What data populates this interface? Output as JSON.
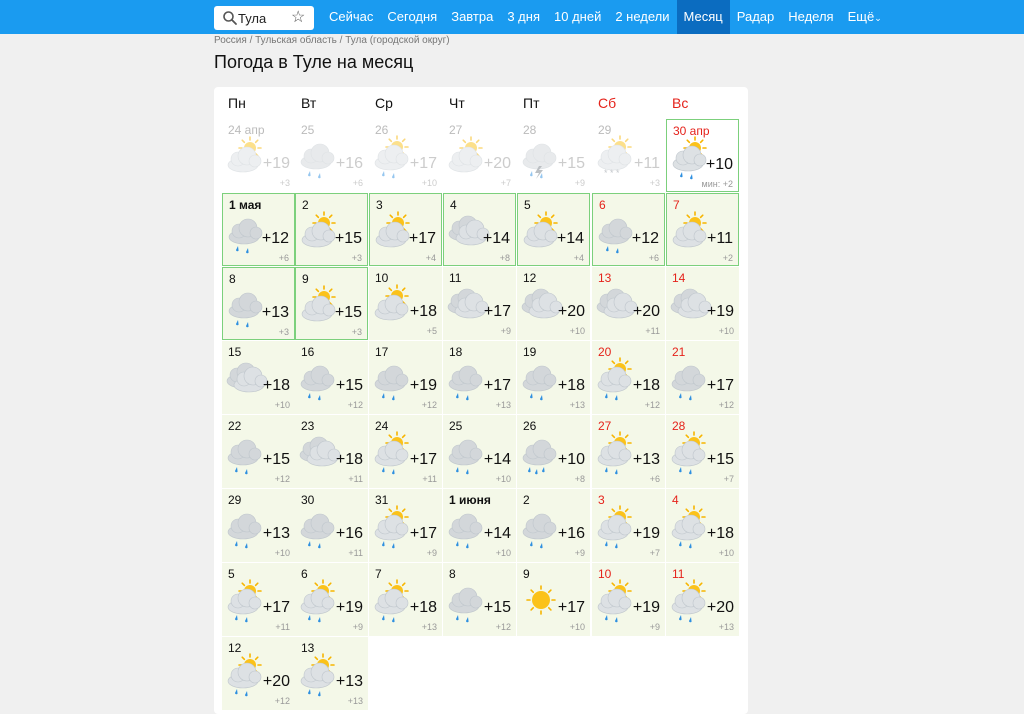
{
  "search": {
    "value": "Тула",
    "star": "☆"
  },
  "nav": [
    {
      "label": "Сейчас",
      "active": false
    },
    {
      "label": "Сегодня",
      "active": false
    },
    {
      "label": "Завтра",
      "active": false
    },
    {
      "label": "3 дня",
      "active": false
    },
    {
      "label": "10 дней",
      "active": false
    },
    {
      "label": "2 недели",
      "active": false
    },
    {
      "label": "Месяц",
      "active": true
    },
    {
      "label": "Радар",
      "active": false
    },
    {
      "label": "Неделя",
      "active": false
    },
    {
      "label": "Ещё",
      "active": false
    }
  ],
  "breadcrumb": "Россия / Тульская область / Тула (городской округ)",
  "title": "Погода в Туле на месяц",
  "weekdays": [
    {
      "label": "Пн",
      "weekend": false
    },
    {
      "label": "Вт",
      "weekend": false
    },
    {
      "label": "Ср",
      "weekend": false
    },
    {
      "label": "Чт",
      "weekend": false
    },
    {
      "label": "Пт",
      "weekend": false
    },
    {
      "label": "Сб",
      "weekend": true
    },
    {
      "label": "Вс",
      "weekend": true
    }
  ],
  "colors": {
    "nav_bg": "#1a9bf0",
    "nav_active": "#0b6cc0",
    "weekend": "#e5231b",
    "future_bg": "#f4f8e8",
    "border": "#7cd07c"
  },
  "min_prefix": "мин: ",
  "days": [
    {
      "label": "24 апр",
      "day": "",
      "max": "+19",
      "min": "+3",
      "icon": "partly-cloudy",
      "past": true
    },
    {
      "label": "25",
      "day": "",
      "max": "+16",
      "min": "+6",
      "icon": "cloudy-rain",
      "past": true
    },
    {
      "label": "26",
      "day": "",
      "max": "+17",
      "min": "+10",
      "icon": "partly-rain",
      "past": true
    },
    {
      "label": "27",
      "day": "",
      "max": "+20",
      "min": "+7",
      "icon": "partly-cloudy",
      "past": true
    },
    {
      "label": "28",
      "day": "",
      "max": "+15",
      "min": "+9",
      "icon": "thunderstorm",
      "past": true
    },
    {
      "label": "29",
      "day": "",
      "max": "+11",
      "min": "+3",
      "icon": "snow",
      "past": true
    },
    {
      "label": "30 апр",
      "day": "",
      "max": "+10",
      "min": "+2",
      "icon": "partly-rain",
      "today": true,
      "red": true
    },
    {
      "label": "1 мая",
      "max": "+12",
      "min": "+6",
      "icon": "cloudy-rain",
      "box": true,
      "bold": true
    },
    {
      "label": "2",
      "max": "+15",
      "min": "+3",
      "icon": "partly-cloudy",
      "box": true
    },
    {
      "label": "3",
      "max": "+17",
      "min": "+4",
      "icon": "partly-cloudy",
      "box": true
    },
    {
      "label": "4",
      "max": "+14",
      "min": "+8",
      "icon": "cloudy",
      "box": true
    },
    {
      "label": "5",
      "max": "+14",
      "min": "+4",
      "icon": "partly-cloudy",
      "box": true
    },
    {
      "label": "6",
      "max": "+12",
      "min": "+6",
      "icon": "cloudy-rain",
      "box": true,
      "red": true
    },
    {
      "label": "7",
      "max": "+11",
      "min": "+2",
      "icon": "partly-cloudy",
      "box": true,
      "red": true
    },
    {
      "label": "8",
      "max": "+13",
      "min": "+3",
      "icon": "cloudy-rain",
      "box": true
    },
    {
      "label": "9",
      "max": "+15",
      "min": "+3",
      "icon": "partly-cloudy",
      "box": true
    },
    {
      "label": "10",
      "max": "+18",
      "min": "+5",
      "icon": "partly-cloudy"
    },
    {
      "label": "11",
      "max": "+17",
      "min": "+9",
      "icon": "cloudy"
    },
    {
      "label": "12",
      "max": "+20",
      "min": "+10",
      "icon": "cloudy"
    },
    {
      "label": "13",
      "max": "+20",
      "min": "+11",
      "icon": "cloudy",
      "red": true
    },
    {
      "label": "14",
      "max": "+19",
      "min": "+10",
      "icon": "cloudy",
      "red": true
    },
    {
      "label": "15",
      "max": "+18",
      "min": "+10",
      "icon": "cloudy"
    },
    {
      "label": "16",
      "max": "+15",
      "min": "+12",
      "icon": "cloudy-rain"
    },
    {
      "label": "17",
      "max": "+19",
      "min": "+12",
      "icon": "cloudy-rain"
    },
    {
      "label": "18",
      "max": "+17",
      "min": "+13",
      "icon": "cloudy-rain"
    },
    {
      "label": "19",
      "max": "+18",
      "min": "+13",
      "icon": "cloudy-rain"
    },
    {
      "label": "20",
      "max": "+18",
      "min": "+12",
      "icon": "partly-rain",
      "red": true
    },
    {
      "label": "21",
      "max": "+17",
      "min": "+12",
      "icon": "cloudy-rain",
      "red": true
    },
    {
      "label": "22",
      "max": "+15",
      "min": "+12",
      "icon": "cloudy-rain"
    },
    {
      "label": "23",
      "max": "+18",
      "min": "+11",
      "icon": "cloudy"
    },
    {
      "label": "24",
      "max": "+17",
      "min": "+11",
      "icon": "partly-rain"
    },
    {
      "label": "25",
      "max": "+14",
      "min": "+10",
      "icon": "cloudy-rain"
    },
    {
      "label": "26",
      "max": "+10",
      "min": "+8",
      "icon": "cloudy-heavy-rain"
    },
    {
      "label": "27",
      "max": "+13",
      "min": "+6",
      "icon": "partly-rain",
      "red": true
    },
    {
      "label": "28",
      "max": "+15",
      "min": "+7",
      "icon": "partly-rain",
      "red": true
    },
    {
      "label": "29",
      "max": "+13",
      "min": "+10",
      "icon": "cloudy-rain"
    },
    {
      "label": "30",
      "max": "+16",
      "min": "+11",
      "icon": "cloudy-rain"
    },
    {
      "label": "31",
      "max": "+17",
      "min": "+9",
      "icon": "partly-rain"
    },
    {
      "label": "1 июня",
      "max": "+14",
      "min": "+10",
      "icon": "cloudy-rain",
      "bold": true
    },
    {
      "label": "2",
      "max": "+16",
      "min": "+9",
      "icon": "cloudy-rain"
    },
    {
      "label": "3",
      "max": "+19",
      "min": "+7",
      "icon": "partly-rain",
      "red": true
    },
    {
      "label": "4",
      "max": "+18",
      "min": "+10",
      "icon": "partly-rain",
      "red": true
    },
    {
      "label": "5",
      "max": "+17",
      "min": "+11",
      "icon": "partly-rain"
    },
    {
      "label": "6",
      "max": "+19",
      "min": "+9",
      "icon": "partly-rain"
    },
    {
      "label": "7",
      "max": "+18",
      "min": "+13",
      "icon": "partly-rain"
    },
    {
      "label": "8",
      "max": "+15",
      "min": "+12",
      "icon": "cloudy-rain"
    },
    {
      "label": "9",
      "max": "+17",
      "min": "+10",
      "icon": "sunny"
    },
    {
      "label": "10",
      "max": "+19",
      "min": "+9",
      "icon": "partly-rain",
      "red": true
    },
    {
      "label": "11",
      "max": "+20",
      "min": "+13",
      "icon": "partly-rain",
      "red": true
    },
    {
      "label": "12",
      "max": "+20",
      "min": "+12",
      "icon": "partly-rain"
    },
    {
      "label": "13",
      "max": "+13",
      "min": "+13",
      "icon": "partly-rain"
    }
  ]
}
